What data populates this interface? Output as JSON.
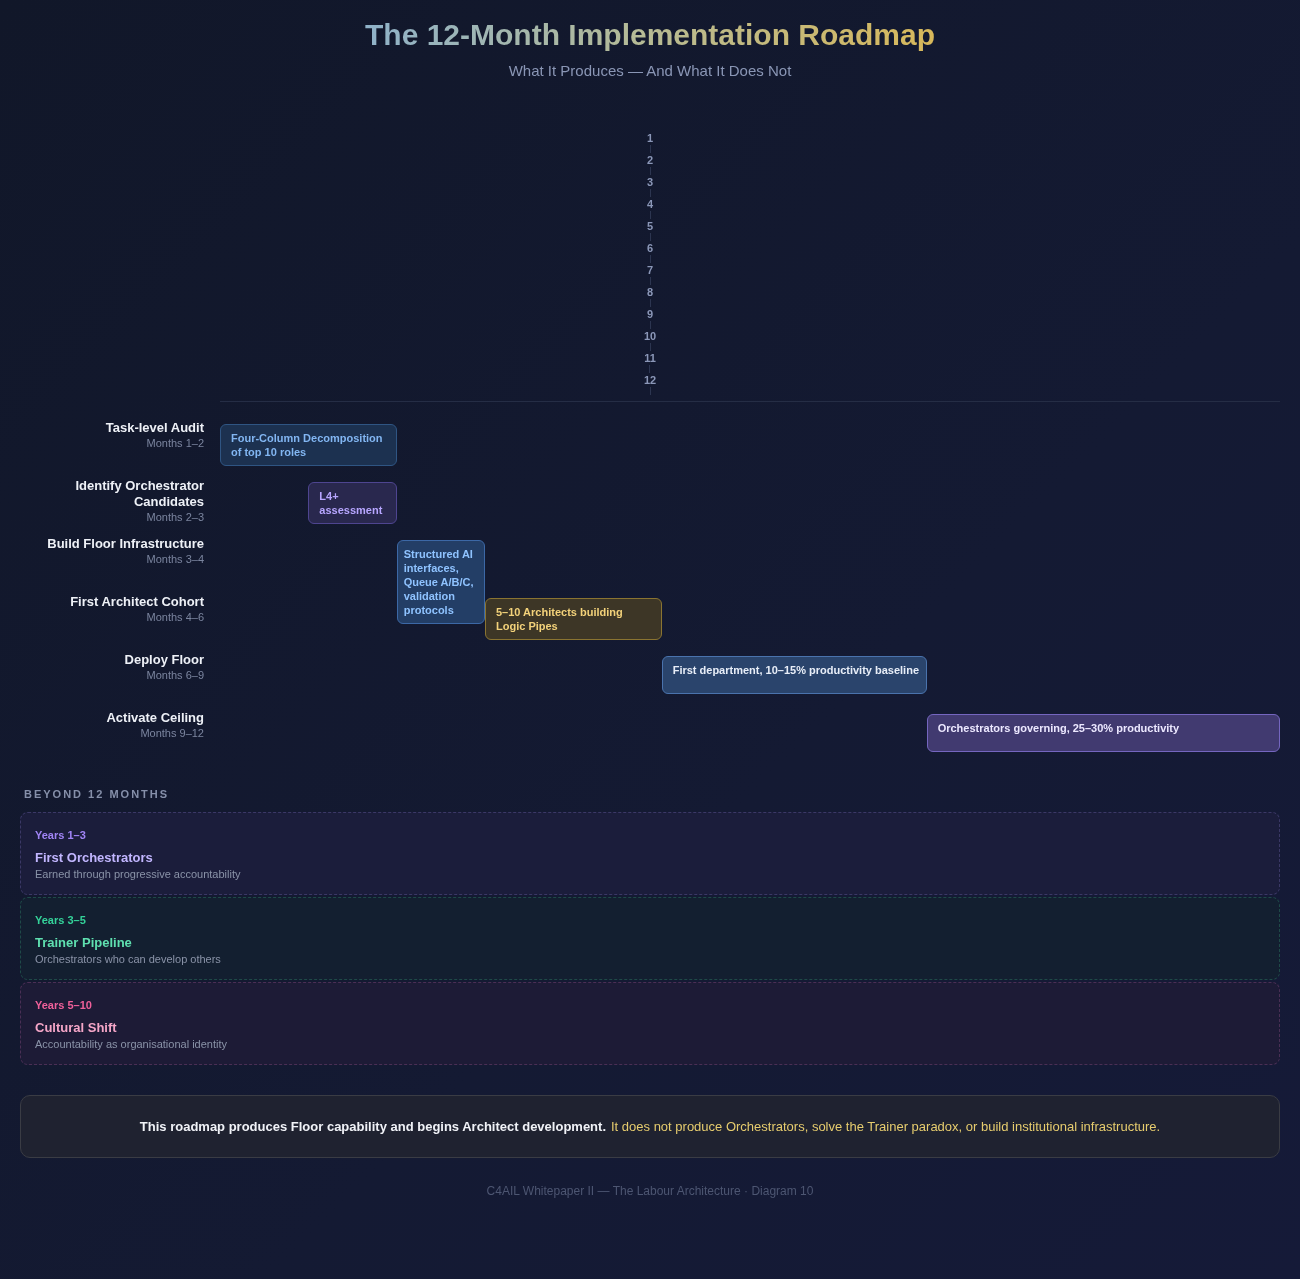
{
  "header": {
    "title": "The 12-Month Implementation Roadmap",
    "subtitle": "What It Produces — And What It Does Not"
  },
  "months": [
    "1",
    "2",
    "3",
    "4",
    "5",
    "6",
    "7",
    "8",
    "9",
    "10",
    "11",
    "12"
  ],
  "phases": [
    {
      "name": "Task-level Audit",
      "period": "Months 1–2",
      "bar": "Four-Column Decomposition of top 10 roles",
      "kind": "analysis"
    },
    {
      "name": "Identify Orchestrator Candidates",
      "period": "Months 2–3",
      "bar": "L4+ assessment",
      "kind": "selection"
    },
    {
      "name": "Build Floor Infrastructure",
      "period": "Months 3–4",
      "bar": "Structured AI interfaces, Queue A/B/C, validation protocols",
      "kind": "infrastructure"
    },
    {
      "name": "First Architect Cohort",
      "period": "Months 4–6",
      "bar": "5–10 Architects building Logic Pipes",
      "kind": "people"
    },
    {
      "name": "Deploy Floor",
      "period": "Months 6–9",
      "bar": "First department, 10–15% productivity baseline",
      "kind": "rollout"
    },
    {
      "name": "Activate Ceiling",
      "period": "Months 9–12",
      "bar": "Orchestrators governing, 25–30% productivity",
      "kind": "governance"
    }
  ],
  "beyond": {
    "heading": "BEYOND 12 MONTHS",
    "cards": [
      {
        "span": "Years 1–3",
        "title": "First Orchestrators",
        "text": "Earned through progressive accountability",
        "kind": "near"
      },
      {
        "span": "Years 3–5",
        "title": "Trainer Pipeline",
        "text": "Orchestrators who can develop others",
        "kind": "mid"
      },
      {
        "span": "Years 5–10",
        "title": "Cultural Shift",
        "text": "Accountability as organisational identity",
        "kind": "long"
      }
    ]
  },
  "note": {
    "statement": "This roadmap produces Floor capability and begins Architect development.",
    "caveat": "It does not produce Orchestrators, solve the Trainer paradox, or build institutional infrastructure."
  },
  "credit": "C4AIL Whitepaper II — The Labour Architecture · Diagram 10"
}
